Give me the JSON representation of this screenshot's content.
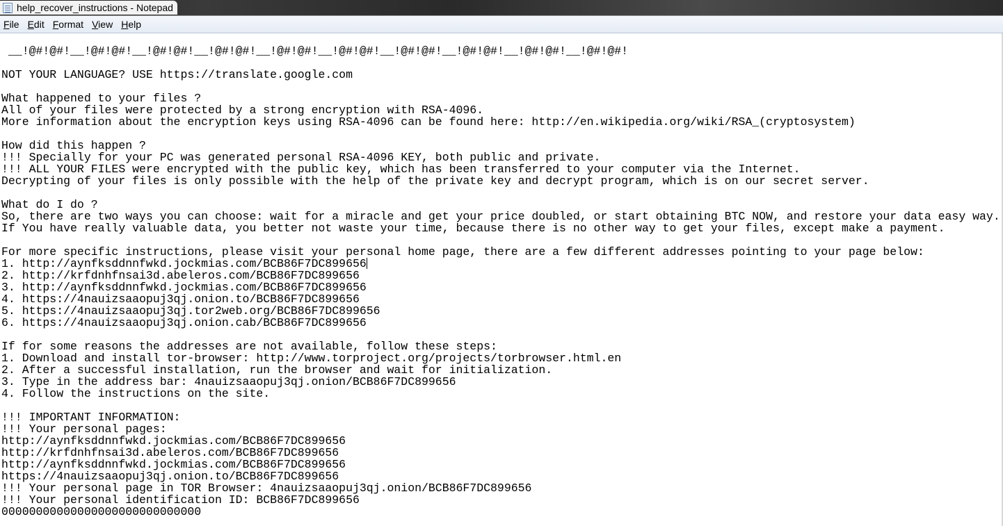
{
  "window": {
    "title": "help_recover_instructions - Notepad",
    "app_icon": "notepad-icon"
  },
  "menu": [
    "File",
    "Edit",
    "Format",
    "View",
    "Help"
  ],
  "document": {
    "lines": [
      " __!@#!@#!__!@#!@#!__!@#!@#!__!@#!@#!__!@#!@#!__!@#!@#!__!@#!@#!__!@#!@#!__!@#!@#!__!@#!@#!",
      "",
      "NOT YOUR LANGUAGE? USE https://translate.google.com",
      "",
      "What happened to your files ?",
      "All of your files were protected by a strong encryption with RSA-4096.",
      "More information about the encryption keys using RSA-4096 can be found here: http://en.wikipedia.org/wiki/RSA_(cryptosystem)",
      "",
      "How did this happen ?",
      "!!! Specially for your PC was generated personal RSA-4096 KEY, both public and private.",
      "!!! ALL YOUR FILES were encrypted with the public key, which has been transferred to your computer via the Internet.",
      "Decrypting of your files is only possible with the help of the private key and decrypt program, which is on our secret server.",
      "",
      "What do I do ?",
      "So, there are two ways you can choose: wait for a miracle and get your price doubled, or start obtaining BTC NOW, and restore your data easy way.",
      "If You have really valuable data, you better not waste your time, because there is no other way to get your files, except make a payment.",
      "",
      "For more specific instructions, please visit your personal home page, there are a few different addresses pointing to your page below:",
      "1. http://aynfksddnnfwkd.jockmias.com/BCB86F7DC899656",
      "2. http://krfdnhfnsai3d.abeleros.com/BCB86F7DC899656",
      "3. http://aynfksddnnfwkd.jockmias.com/BCB86F7DC899656",
      "4. https://4nauizsaaopuj3qj.onion.to/BCB86F7DC899656",
      "5. https://4nauizsaaopuj3qj.tor2web.org/BCB86F7DC899656",
      "6. https://4nauizsaaopuj3qj.onion.cab/BCB86F7DC899656",
      "",
      "If for some reasons the addresses are not available, follow these steps:",
      "1. Download and install tor-browser: http://www.torproject.org/projects/torbrowser.html.en",
      "2. After a successful installation, run the browser and wait for initialization.",
      "3. Type in the address bar: 4nauizsaaopuj3qj.onion/BCB86F7DC899656",
      "4. Follow the instructions on the site.",
      "",
      "!!! IMPORTANT INFORMATION:",
      "!!! Your personal pages:",
      "http://aynfksddnnfwkd.jockmias.com/BCB86F7DC899656",
      "http://krfdnhfnsai3d.abeleros.com/BCB86F7DC899656",
      "http://aynfksddnnfwkd.jockmias.com/BCB86F7DC899656",
      "https://4nauizsaaopuj3qj.onion.to/BCB86F7DC899656",
      "!!! Your personal page in TOR Browser: 4nauizsaaopuj3qj.onion/BCB86F7DC899656",
      "!!! Your personal identification ID: BCB86F7DC899656",
      "00000000000000000000000000000"
    ]
  }
}
